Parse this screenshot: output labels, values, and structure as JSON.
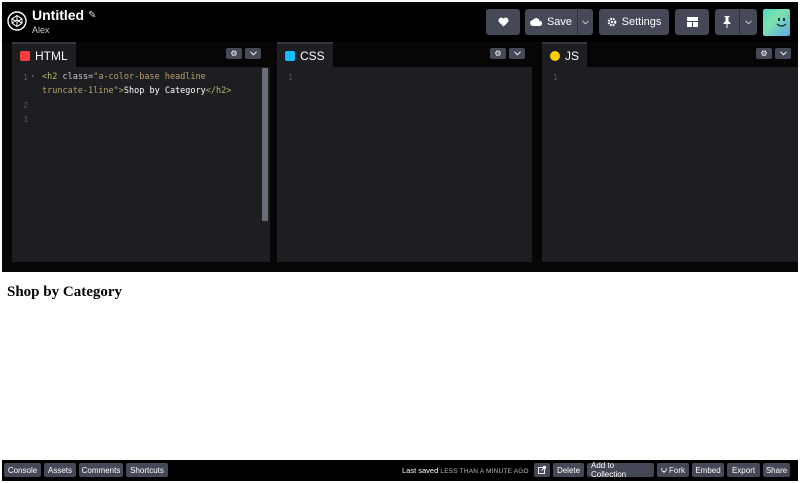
{
  "header": {
    "title": "Untitled",
    "author": "Alex",
    "save_label": "Save",
    "settings_label": "Settings"
  },
  "editors": {
    "html": {
      "label": "HTML",
      "icon_color": "#ff3c41",
      "lines": [
        "1",
        "2",
        "3"
      ],
      "code": {
        "open_tag": "<h2 ",
        "attr_name": "class=",
        "attr_value_1": "\"a-color-base headline",
        "attr_value_2": "truncate-1line\"",
        "tag_close": ">",
        "text": "Shop by Category",
        "close_tag": "</h2>"
      }
    },
    "css": {
      "label": "CSS",
      "icon_color": "#0ebeff",
      "lines": [
        "1"
      ]
    },
    "js": {
      "label": "JS",
      "icon_color": "#fcd000",
      "lines": [
        "1"
      ]
    }
  },
  "preview": {
    "heading": "Shop by Category"
  },
  "footer": {
    "console": "Console",
    "assets": "Assets",
    "comments": "Comments",
    "shortcuts": "Shortcuts",
    "last_saved_label": "Last saved",
    "last_saved_value": "LESS THAN A MINUTE AGO",
    "delete": "Delete",
    "add_to_collection": "Add to Collection",
    "fork": "Fork",
    "embed": "Embed",
    "export": "Export",
    "share": "Share"
  },
  "colors": {
    "header_bg": "#000000",
    "button_bg": "#444857",
    "editor_bg": "#1d1e22"
  }
}
